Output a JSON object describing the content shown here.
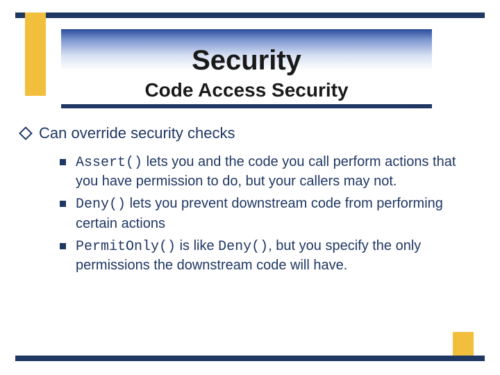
{
  "colors": {
    "navy": "#1f3763",
    "gold": "#f2bf3c"
  },
  "header": {
    "title": "Security",
    "subtitle": "Code Access Security"
  },
  "main": {
    "bullet": "Can override security checks",
    "subs": [
      {
        "code": "Assert()",
        "text": " lets you and the code you call perform actions that you have permission to do, but your callers may not."
      },
      {
        "code": "Deny()",
        "text": " lets you prevent downstream code from performing certain actions"
      },
      {
        "code": "PermitOnly()",
        "mid": " is like ",
        "code2": "Deny()",
        "text": ", but you specify the only permissions the downstream code will have."
      }
    ]
  }
}
